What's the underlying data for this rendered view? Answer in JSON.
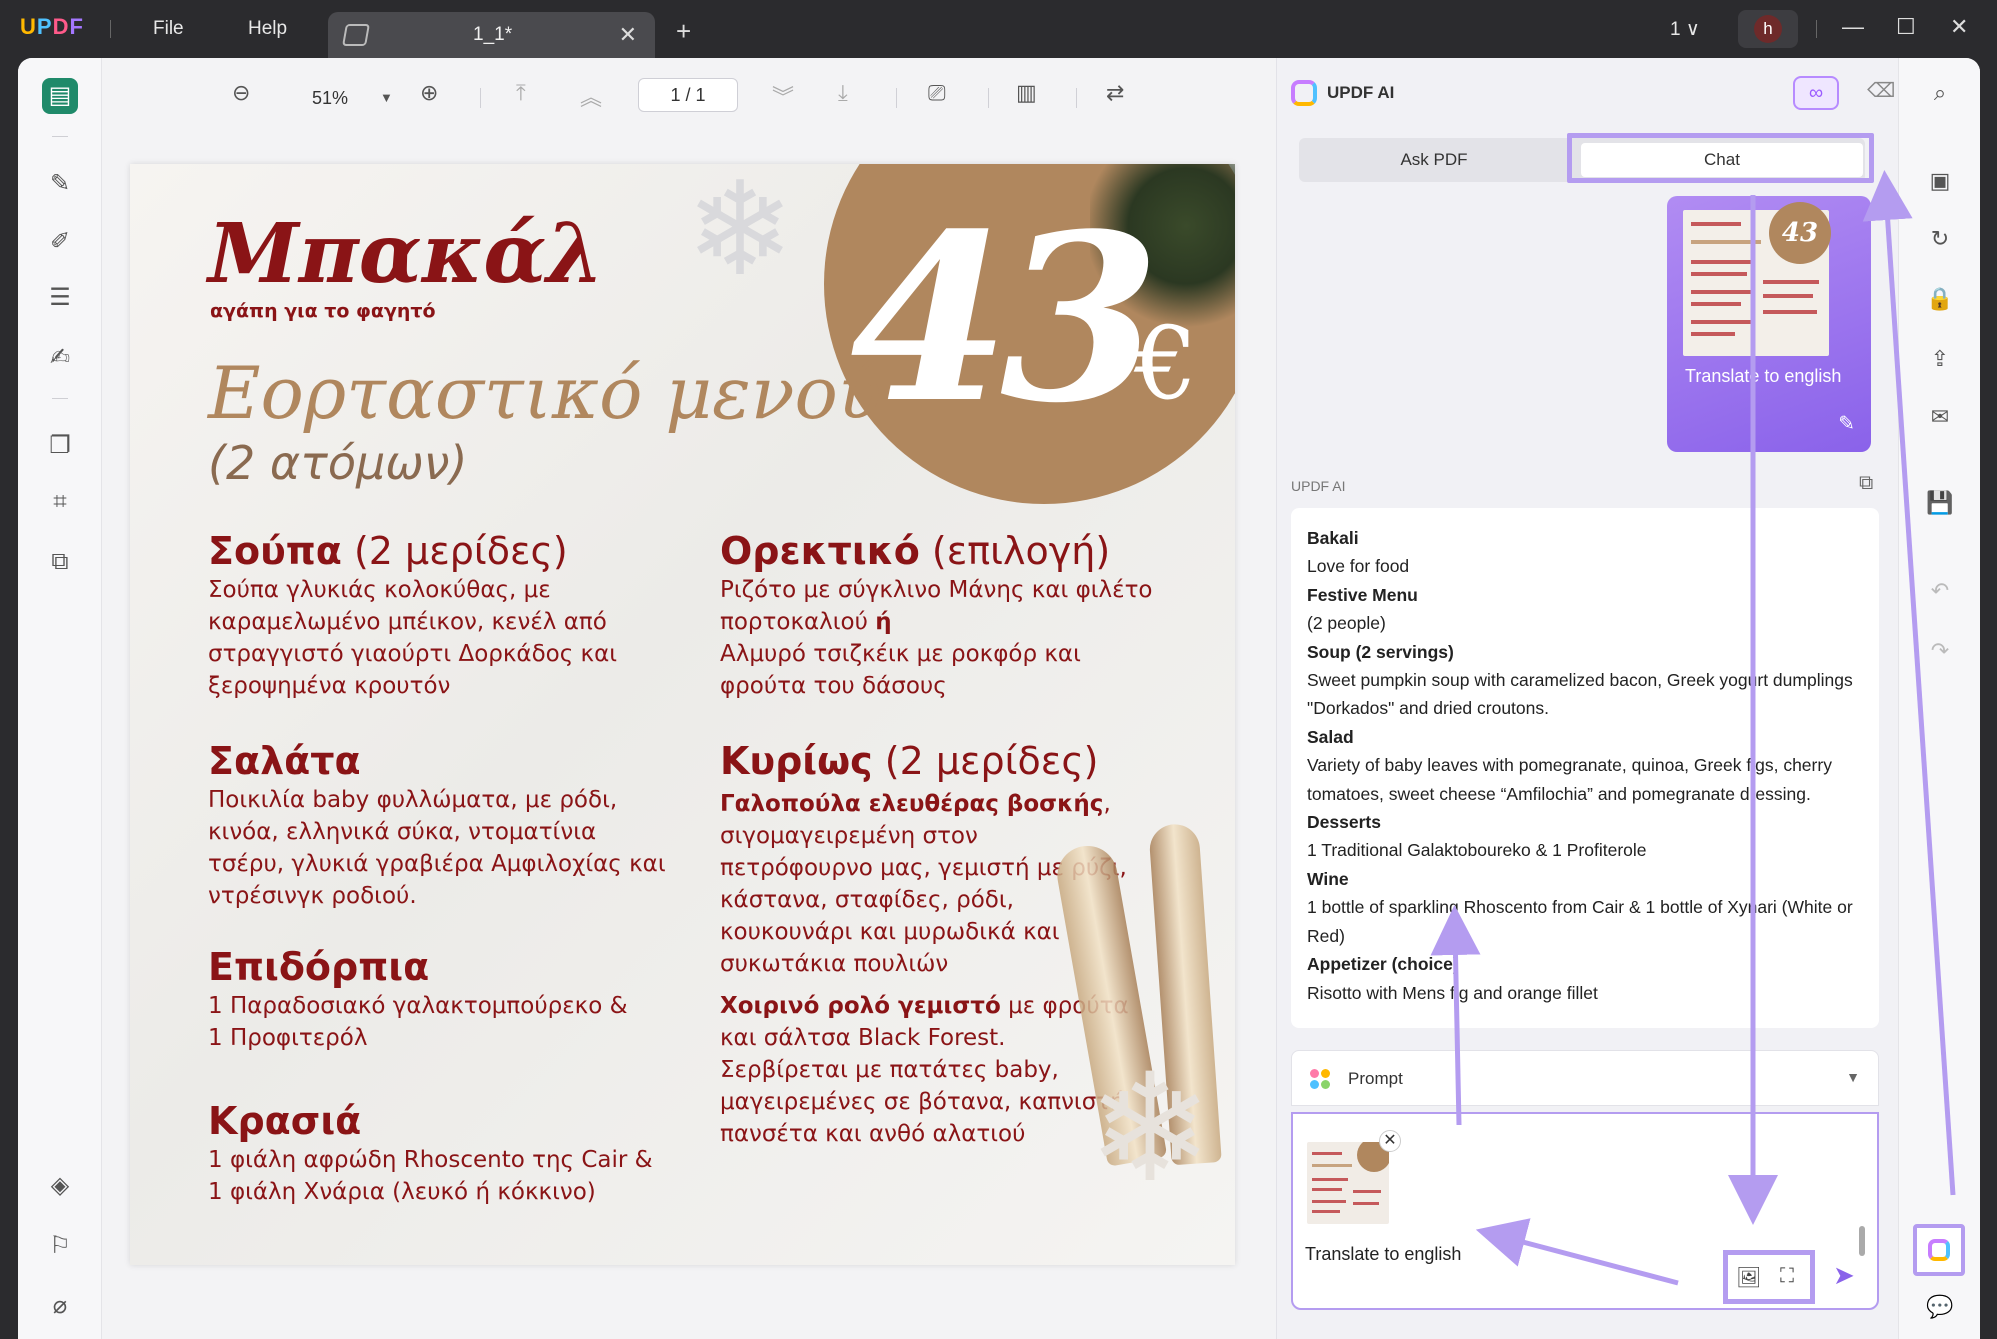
{
  "titlebar": {
    "logo": {
      "u": "U",
      "p": "P",
      "d": "D",
      "f": "F"
    },
    "menu_file": "File",
    "menu_help": "Help",
    "tab_title": "1_1*",
    "tab_close": "✕",
    "tab_add": "+",
    "page_selector": "1 ∨",
    "avatar_letter": "h",
    "win_min": "—",
    "win_max": "☐",
    "win_close": "✕"
  },
  "toolbar": {
    "zoom_out": "⊖",
    "zoom_value": "51%",
    "zoom_caret": "▼",
    "zoom_in": "⊕",
    "first_page": "⤒",
    "prev_page": "︽",
    "page_indicator": "1  /  1",
    "next_page": "︾",
    "last_page": "⤓",
    "presentation": "⎚",
    "two_page": "▥",
    "translate": "⇄"
  },
  "document": {
    "price_number": "43",
    "price_currency": "€",
    "brand": "Μπακάλ",
    "brand_sub": "αγάπη για το φαγητό",
    "menu_title": "Εορταστικό μενού",
    "menu_sub": "(2 ατόμων)",
    "soup": {
      "h_bold": "Σούπα",
      "h_rest": " (2 μερίδες)",
      "t": "Σούπα γλυκιάς κολοκύθας, με καραμελωμένο μπέικον, κενέλ από στραγγιστό γιαούρτι Δορκάδος και ξεροψημένα κρουτόν"
    },
    "salad": {
      "h_bold": "Σαλάτα",
      "t": "Ποικιλία baby φυλλώματα, με ρόδι, κινόα, ελληνικά σύκα, ντοματίνια τσέρυ, γλυκιά γραβιέρα Αμφιλοχίας και ντρέσινγκ ροδιού."
    },
    "dessert": {
      "h_bold": "Επιδόρπια",
      "t": "1 Παραδοσιακό γαλακτομπούρεκο & 1 Προφιτερόλ"
    },
    "wine": {
      "h_bold": "Κρασιά",
      "t": "1 φιάλη αφρώδη Rhoscento της Cair & 1 φιάλη Χνάρια (λευκό ή κόκκινο)"
    },
    "appetizer": {
      "h_bold": "Ορεκτικό",
      "h_rest": " (επιλογή)",
      "t1": "Ριζότο με σύγκλινο Μάνης και φιλέτο πορτοκαλιού ",
      "t_or": "ή",
      "t2": "Αλμυρό τσιζκέικ με ροκφόρ και φρούτα του δάσους"
    },
    "main": {
      "h_bold": "Κυρίως",
      "h_rest": " (2 μερίδες)",
      "t1_bold": "Γαλοπούλα ελευθέρας βοσκής",
      "t1": ", σιγομαγειρεμένη στον πετρόφουρνο μας, γεμιστή με ρύζι, κάστανα, σταφίδες, ρόδι, κουκουνάρι και μυρωδικά και συκωτάκια πουλιών",
      "t2_bold": "Χοιρινό ρολό γεμιστό",
      "t2": " με φρούτα και σάλτσα Black Forest. Σερβίρεται με πατάτες baby, μαγειρεμένες σε βότανα, καπνιστή πανσέτα και ανθό αλατιού"
    }
  },
  "ai": {
    "title": "UPDF AI",
    "infinity": "∞",
    "tab_ask": "Ask PDF",
    "tab_chat": "Chat",
    "thumb_price": "43",
    "user_message": "Translate to english",
    "edit": "✎",
    "response_label": "UPDF AI",
    "share": "⧉",
    "answer": [
      {
        "t": "Bakali",
        "b": true
      },
      {
        "t": "Love for food",
        "b": false
      },
      {
        "t": "Festive Menu",
        "b": true
      },
      {
        "t": "(2 people)",
        "b": false
      },
      {
        "t": "Soup (2 servings)",
        "b": true
      },
      {
        "t": "Sweet pumpkin soup with caramelized bacon, Greek yogurt dumplings \"Dorkados\" and dried croutons.",
        "b": false
      },
      {
        "t": "Salad",
        "b": true
      },
      {
        "t": "Variety of baby leaves with pomegranate, quinoa, Greek figs, cherry tomatoes, sweet cheese “Amfilochia” and pomegranate dressing.",
        "b": false
      },
      {
        "t": "Desserts",
        "b": true
      },
      {
        "t": "1 Traditional Galaktoboureko & 1 Profiterole",
        "b": false
      },
      {
        "t": "Wine",
        "b": true
      },
      {
        "t": "1 bottle of sparkling Rhoscento from Cair & 1 bottle of Xynari (White or Red)",
        "b": false
      },
      {
        "t": "Appetizer (choice)",
        "b": true
      },
      {
        "t": "Risotto with Mens fig and orange fillet",
        "b": false
      }
    ],
    "prompt_label": "Prompt",
    "prompt_caret": "▼",
    "thumb_remove": "✕",
    "input_text": "Translate to english",
    "attach_image": "🖼",
    "screenshot": "⛶",
    "send": "➤"
  },
  "colors": {
    "accent": "#8a62ea",
    "highlight": "#b49cf0",
    "menu_red": "#8a1416",
    "menu_gold": "#b0875e"
  }
}
